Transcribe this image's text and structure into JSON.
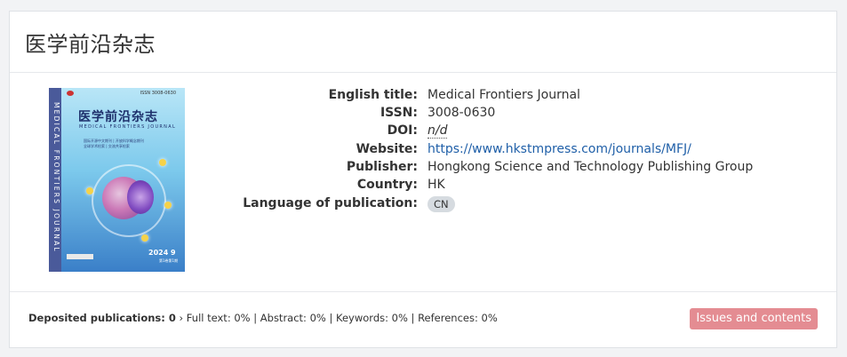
{
  "journal": {
    "title": "医学前沿杂志",
    "cover": {
      "issn": "ISSN 3008-0630",
      "title_cn": "医学前沿杂志",
      "title_en": "MEDICAL FRONTIERS JOURNAL",
      "spine": "MEDICAL FRONTIERS JOURNAL",
      "tagline1": "国际开源中文期刊 | 开放科学概念期刊",
      "tagline2": "全球学术检索 | 交流共享检索",
      "year": "2024 9",
      "volume": "第1卷第1期"
    }
  },
  "details": [
    {
      "label": "English title:",
      "value": "Medical Frontiers Journal"
    },
    {
      "label": "ISSN:",
      "value": "3008-0630"
    },
    {
      "label": "DOI:",
      "value": "n/d"
    },
    {
      "label": "Website:",
      "value": "https://www.hkstmpress.com/journals/MFJ/"
    },
    {
      "label": "Publisher:",
      "value": "Hongkong Science and Technology Publishing Group"
    },
    {
      "label": "Country:",
      "value": "HK"
    },
    {
      "label": "Language of publication:",
      "value": "CN"
    }
  ],
  "footer": {
    "deposited_label": "Deposited publications: 0",
    "stats": "› Full text: 0% | Abstract: 0% | Keywords: 0% | References: 0%",
    "button": "Issues and contents"
  },
  "colors": {
    "button_bg": "#e48c92",
    "link": "#1f5fa8"
  }
}
